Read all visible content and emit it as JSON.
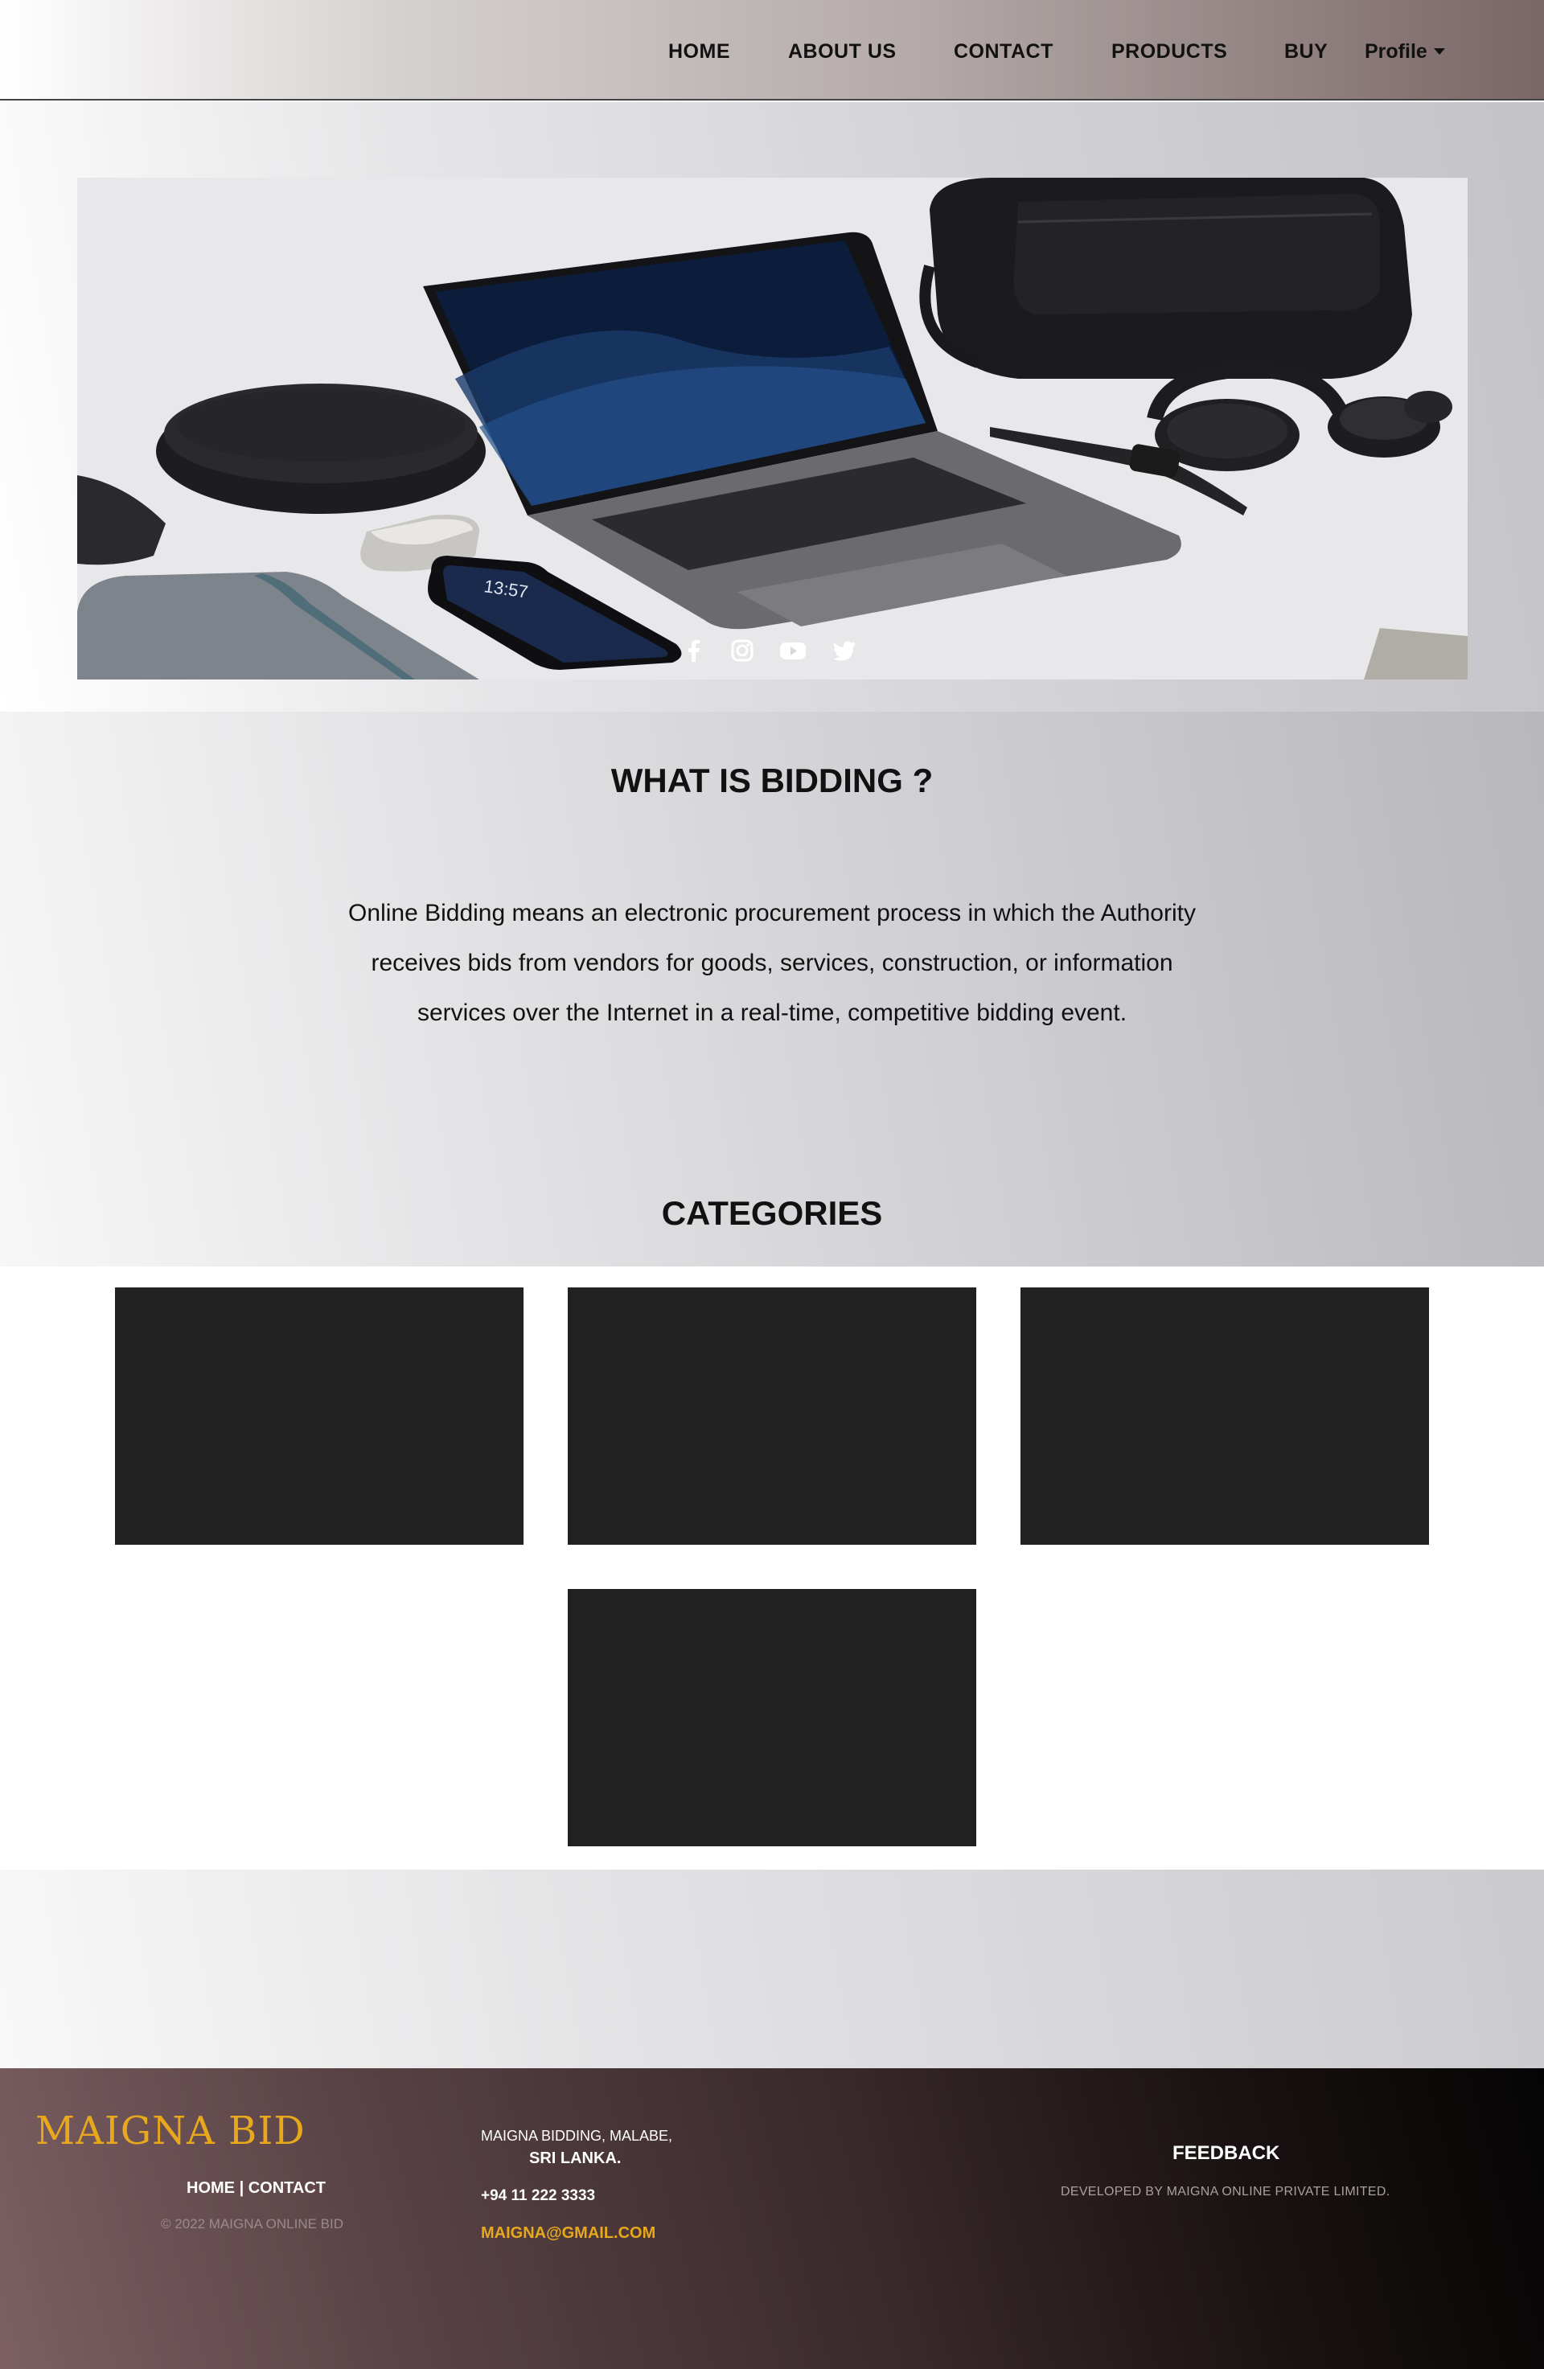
{
  "nav": {
    "items": [
      "HOME",
      "ABOUT US",
      "CONTACT",
      "PRODUCTS",
      "BUY"
    ],
    "profile": "Profile"
  },
  "hero": {
    "phone_time": "13:57",
    "social_icons": [
      "facebook-icon",
      "instagram-icon",
      "youtube-icon",
      "twitter-icon"
    ]
  },
  "bidding": {
    "title": "WHAT IS BIDDING ?",
    "lines": [
      "Online Bidding means an electronic procurement process in which the Authority",
      "receives bids from vendors for goods, services, construction, or information",
      "services over the Internet in a real-time, competitive bidding event."
    ]
  },
  "categories": {
    "title": "CATEGORIES",
    "card_color": "#212121"
  },
  "footer": {
    "brand": "MAIGNA BID",
    "links": [
      "HOME",
      "CONTACT"
    ],
    "separator": "|",
    "copyright": "© 2022 MAIGNA ONLINE BID",
    "address_line1": "MAIGNA BIDDING, MALABE,",
    "address_line2": "SRI LANKA.",
    "phone": "+94 11 222 3333",
    "email": "MAIGNA@GMAIL.COM",
    "feedback": "FEEDBACK",
    "developer": "DEVELOPED BY MAIGNA ONLINE PRIVATE LIMITED.",
    "accent_color": "#e8a81c"
  }
}
